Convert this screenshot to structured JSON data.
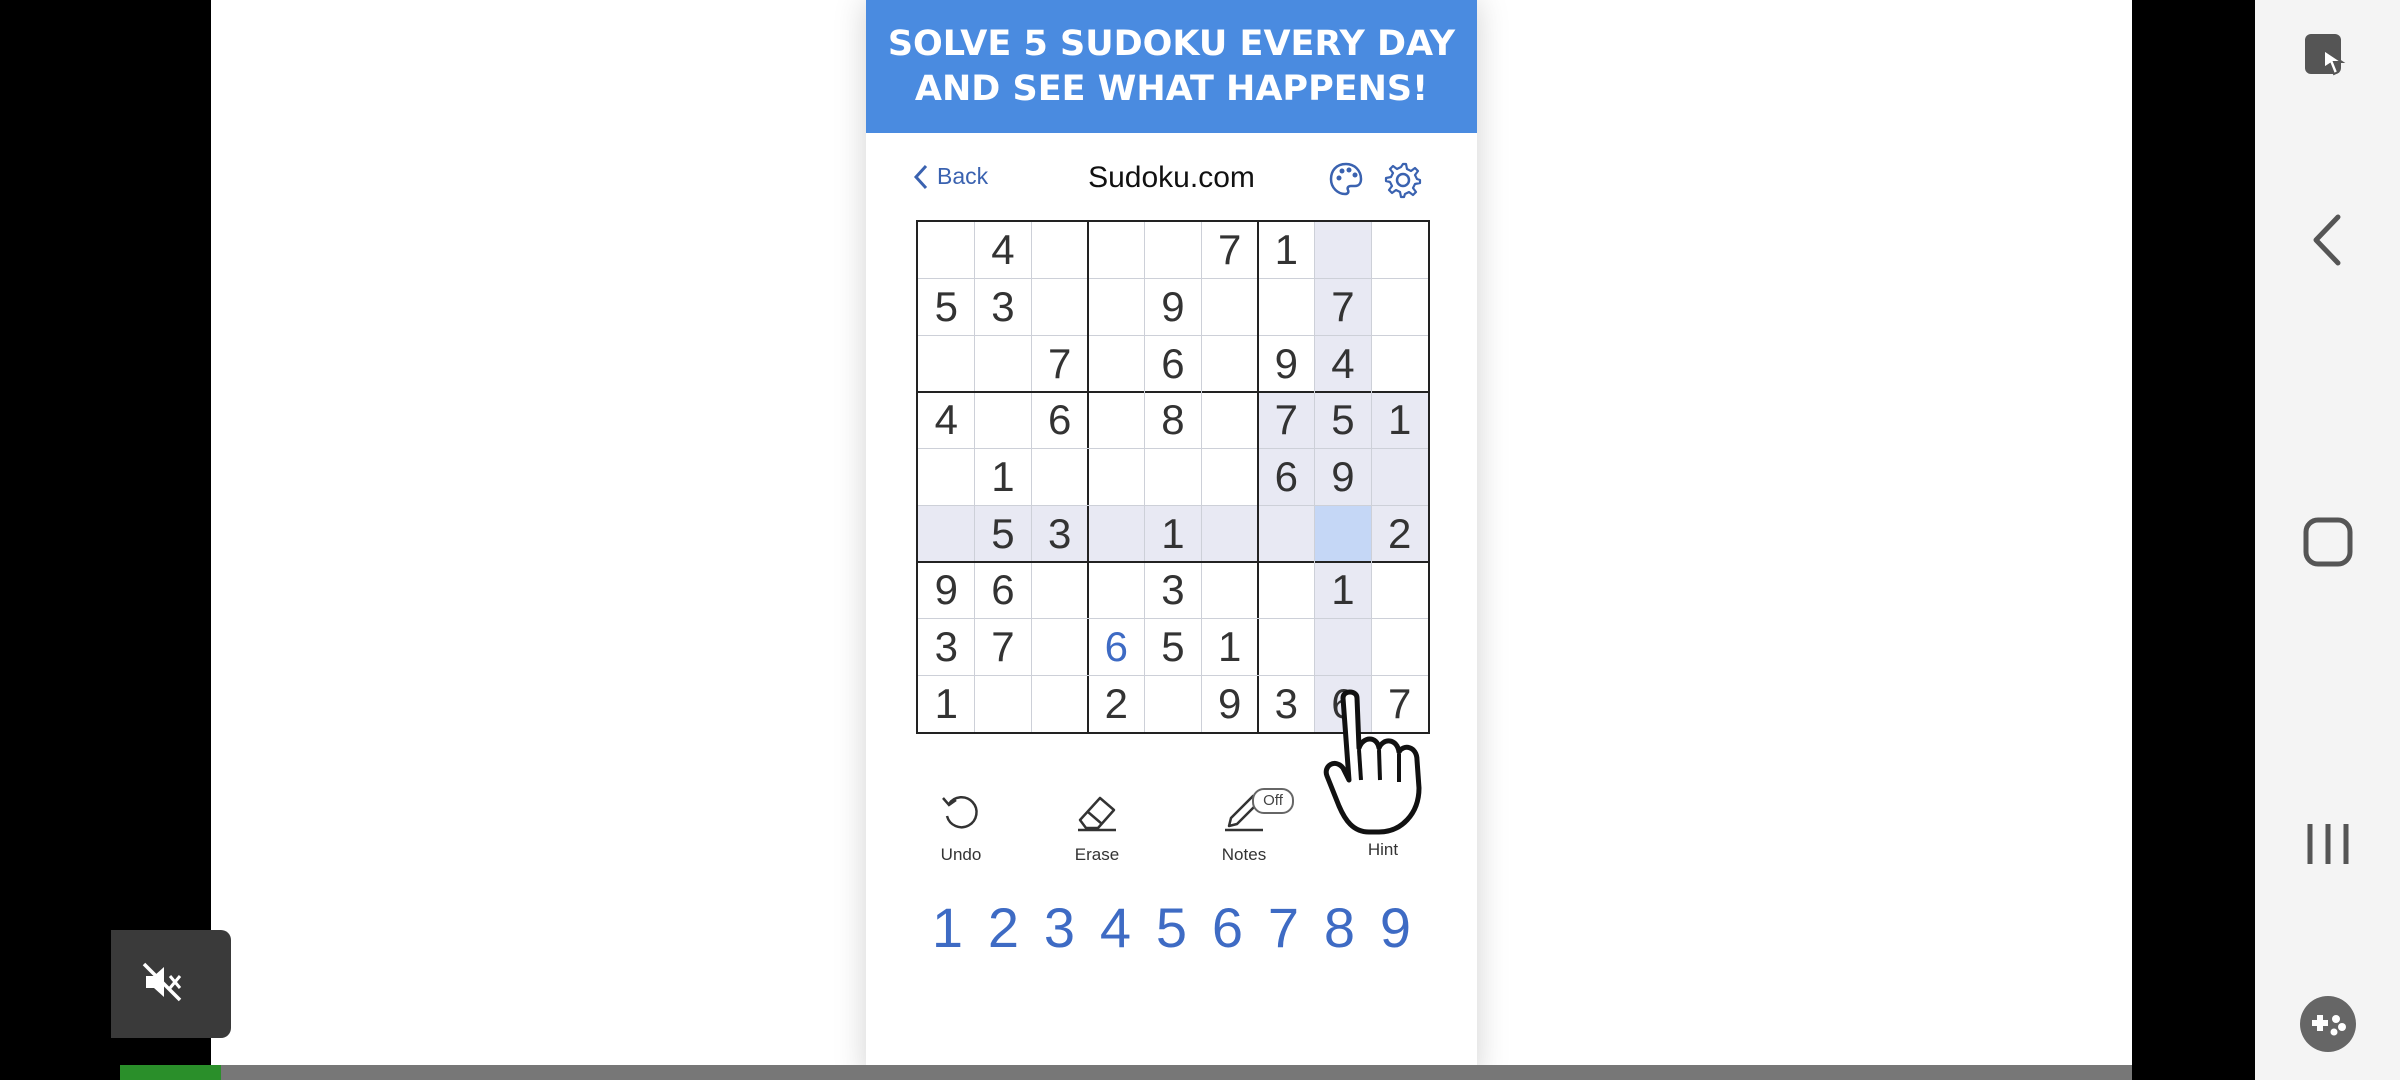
{
  "banner": {
    "line1": "SOLVE 5 SUDOKU EVERY DAY",
    "line2": "AND SEE WHAT HAPPENS!"
  },
  "header": {
    "back_label": "Back",
    "title": "Sudoku.com"
  },
  "grid": [
    [
      "",
      "4",
      "",
      "",
      "",
      "7",
      "1",
      "",
      ""
    ],
    [
      "5",
      "3",
      "",
      "",
      "9",
      "",
      "",
      "7",
      ""
    ],
    [
      "",
      "",
      "7",
      "",
      "6",
      "",
      "9",
      "4",
      ""
    ],
    [
      "4",
      "",
      "6",
      "",
      "8",
      "",
      "7",
      "5",
      "1"
    ],
    [
      "",
      "1",
      "",
      "",
      "",
      "",
      "6",
      "9",
      ""
    ],
    [
      "",
      "5",
      "3",
      "",
      "1",
      "",
      "",
      "",
      "2"
    ],
    [
      "9",
      "6",
      "",
      "",
      "3",
      "",
      "",
      "1",
      ""
    ],
    [
      "3",
      "7",
      "",
      "6",
      "5",
      "1",
      "",
      "",
      ""
    ],
    [
      "1",
      "",
      "",
      "2",
      "",
      "9",
      "3",
      "6",
      "7"
    ]
  ],
  "selected_cell": {
    "row": 5,
    "col": 7
  },
  "user_entered_cells": [
    {
      "row": 7,
      "col": 3
    }
  ],
  "tools": {
    "undo": "Undo",
    "erase": "Erase",
    "notes": "Notes",
    "notes_state": "Off",
    "hint": "Hint"
  },
  "numpad": [
    "1",
    "2",
    "3",
    "4",
    "5",
    "6",
    "7",
    "8",
    "9"
  ],
  "colors": {
    "accent": "#3e6bc4",
    "banner": "#4a8be0",
    "highlight": "#e8e9f3",
    "selected": "#c5d7f6",
    "progress": "#2a8f2a"
  },
  "video_progress": 0.05,
  "icons": {
    "palette": "palette-icon",
    "settings": "gear-icon",
    "mute": "mute-icon"
  }
}
